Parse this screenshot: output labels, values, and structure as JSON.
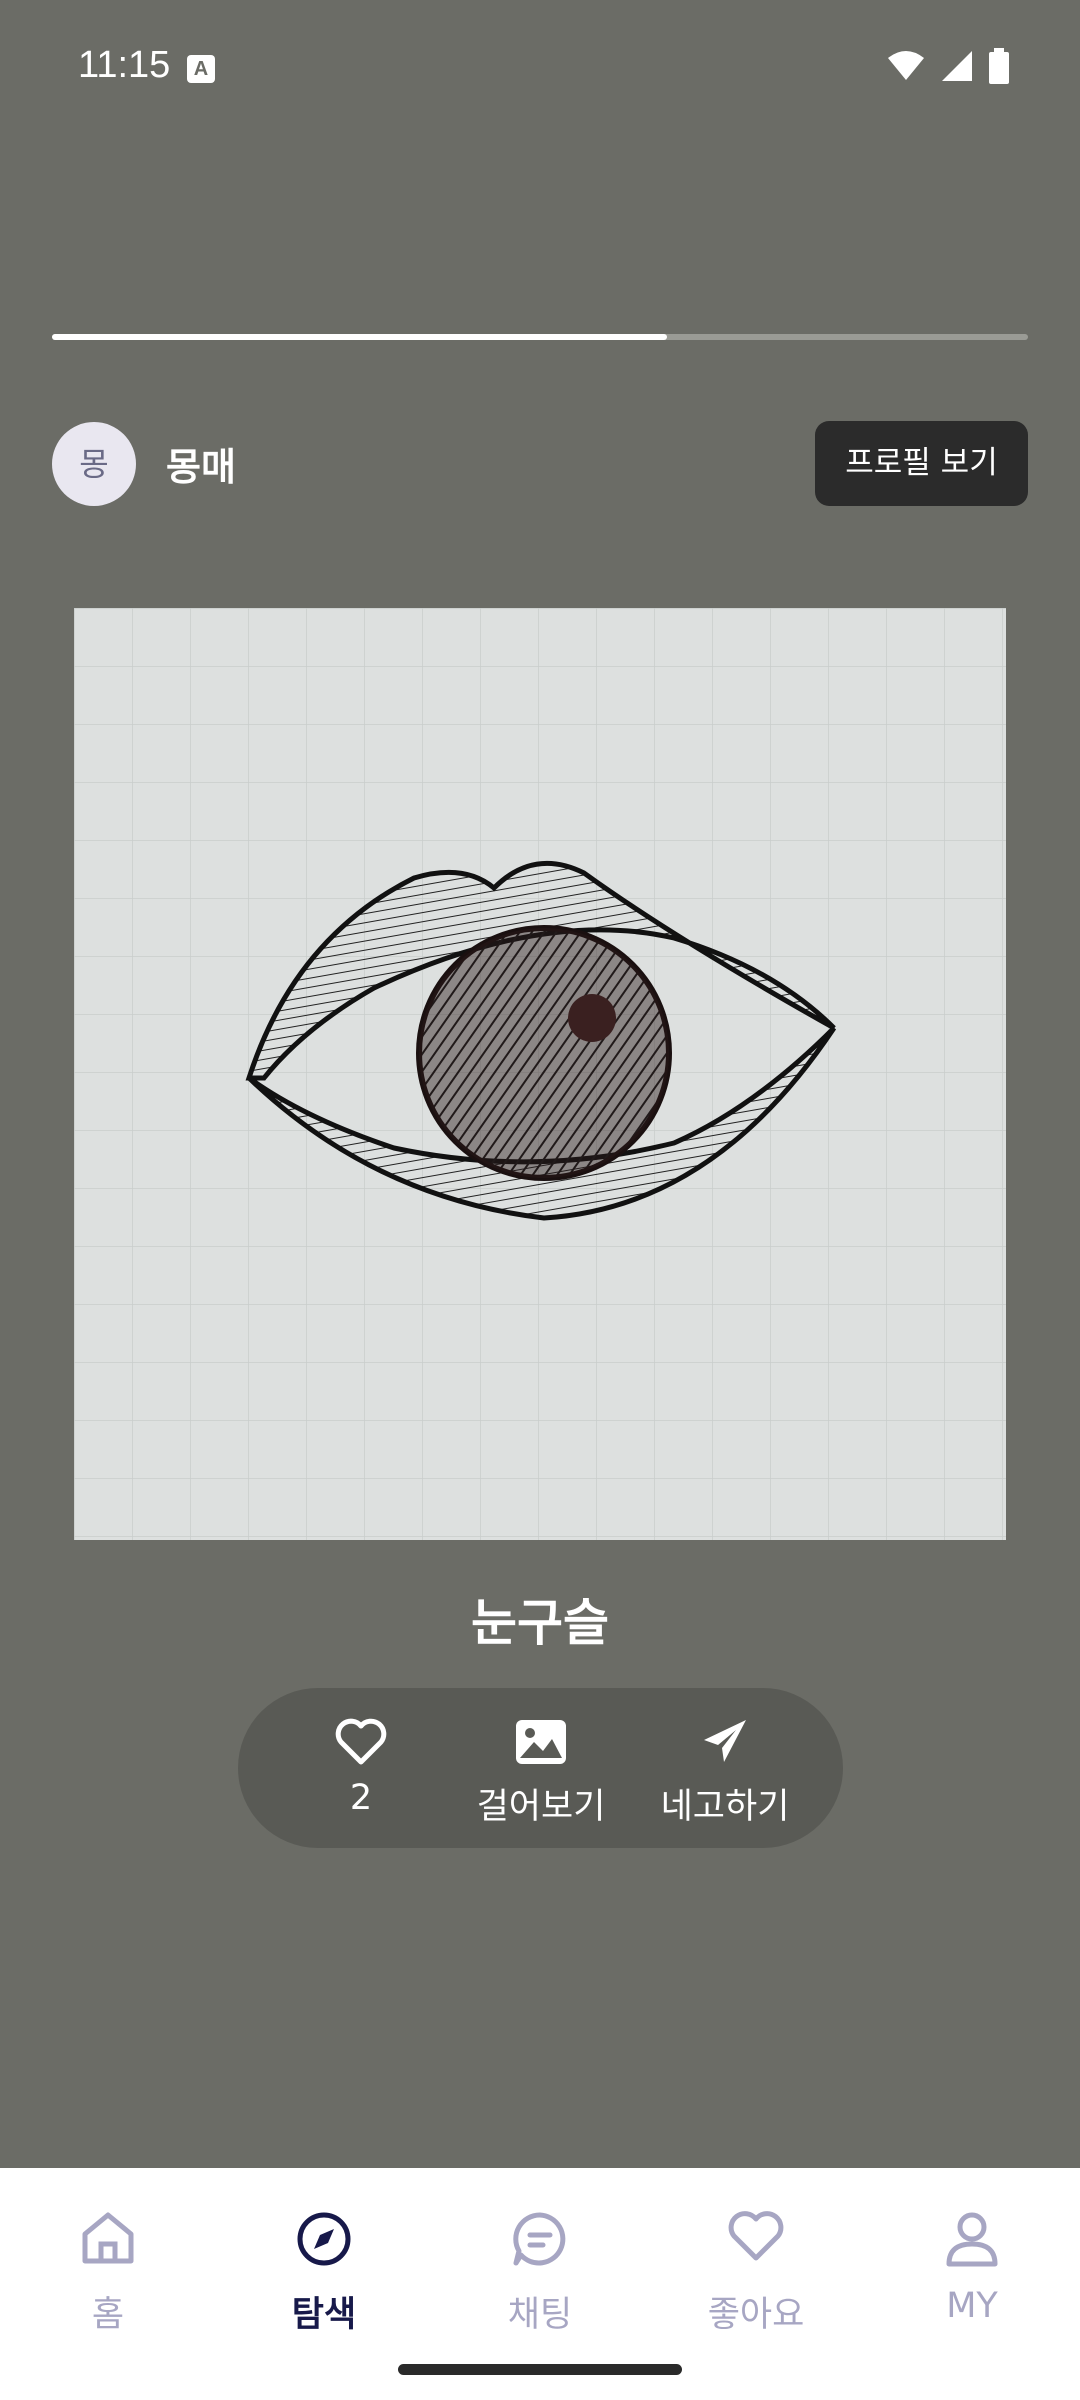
{
  "status_bar": {
    "time": "11:15",
    "indicator_letter": "A"
  },
  "progress": {
    "fraction": 0.63
  },
  "author": {
    "avatar_initial": "몽",
    "name": "몽매",
    "profile_button": "프로필 보기"
  },
  "artwork": {
    "title": "눈구슬"
  },
  "actions": {
    "like": {
      "icon": "heart-outline-icon",
      "label": "2"
    },
    "hang": {
      "icon": "image-icon",
      "label": "걸어보기"
    },
    "offer": {
      "icon": "send-icon",
      "label": "네고하기"
    }
  },
  "nav": {
    "items": [
      {
        "label": "홈",
        "icon": "home-icon"
      },
      {
        "label": "탐색",
        "icon": "compass-icon",
        "active": true
      },
      {
        "label": "채팅",
        "icon": "chat-icon"
      },
      {
        "label": "좋아요",
        "icon": "heart-icon"
      },
      {
        "label": "MY",
        "icon": "person-icon"
      }
    ]
  },
  "colors": {
    "background": "#6b6c66",
    "nav_active": "#17194a",
    "nav_inactive": "#a7a6c3"
  }
}
